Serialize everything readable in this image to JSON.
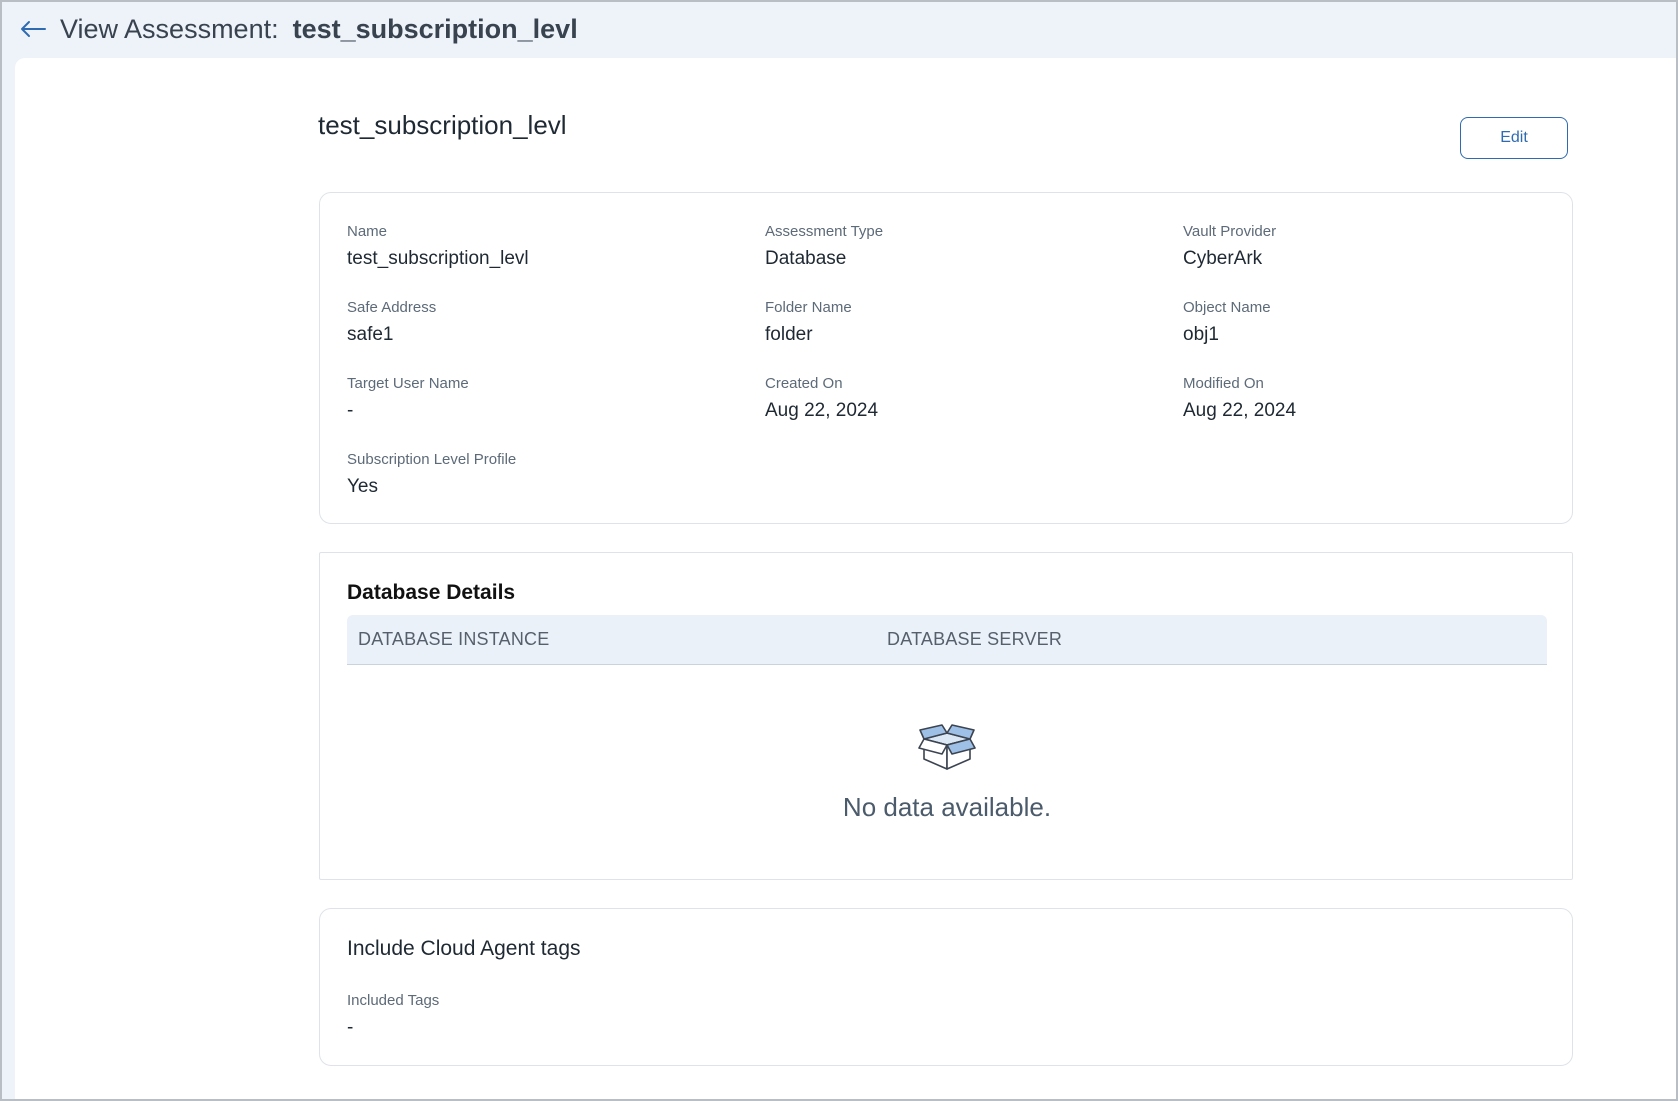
{
  "header": {
    "label": "View Assessment:",
    "name": "test_subscription_levl"
  },
  "page": {
    "title": "test_subscription_levl",
    "edit_label": "Edit"
  },
  "details": {
    "fields": [
      {
        "label": "Name",
        "value": "test_subscription_levl"
      },
      {
        "label": "Assessment Type",
        "value": "Database"
      },
      {
        "label": "Vault Provider",
        "value": "CyberArk"
      },
      {
        "label": "Safe Address",
        "value": "safe1"
      },
      {
        "label": "Folder Name",
        "value": "folder"
      },
      {
        "label": "Object Name",
        "value": "obj1"
      },
      {
        "label": "Target User Name",
        "value": "-"
      },
      {
        "label": "Created On",
        "value": "Aug 22, 2024"
      },
      {
        "label": "Modified On",
        "value": "Aug 22, 2024"
      },
      {
        "label": "Subscription Level Profile",
        "value": "Yes"
      }
    ]
  },
  "database": {
    "title": "Database Details",
    "columns": [
      "DATABASE INSTANCE",
      "DATABASE SERVER"
    ],
    "empty_text": "No data available."
  },
  "tags": {
    "title": "Include Cloud Agent tags",
    "label": "Included Tags",
    "value": "-"
  },
  "colors": {
    "accent": "#2f6bb1",
    "header_bg": "#eef3f9",
    "table_head_bg": "#ebf1f8"
  }
}
